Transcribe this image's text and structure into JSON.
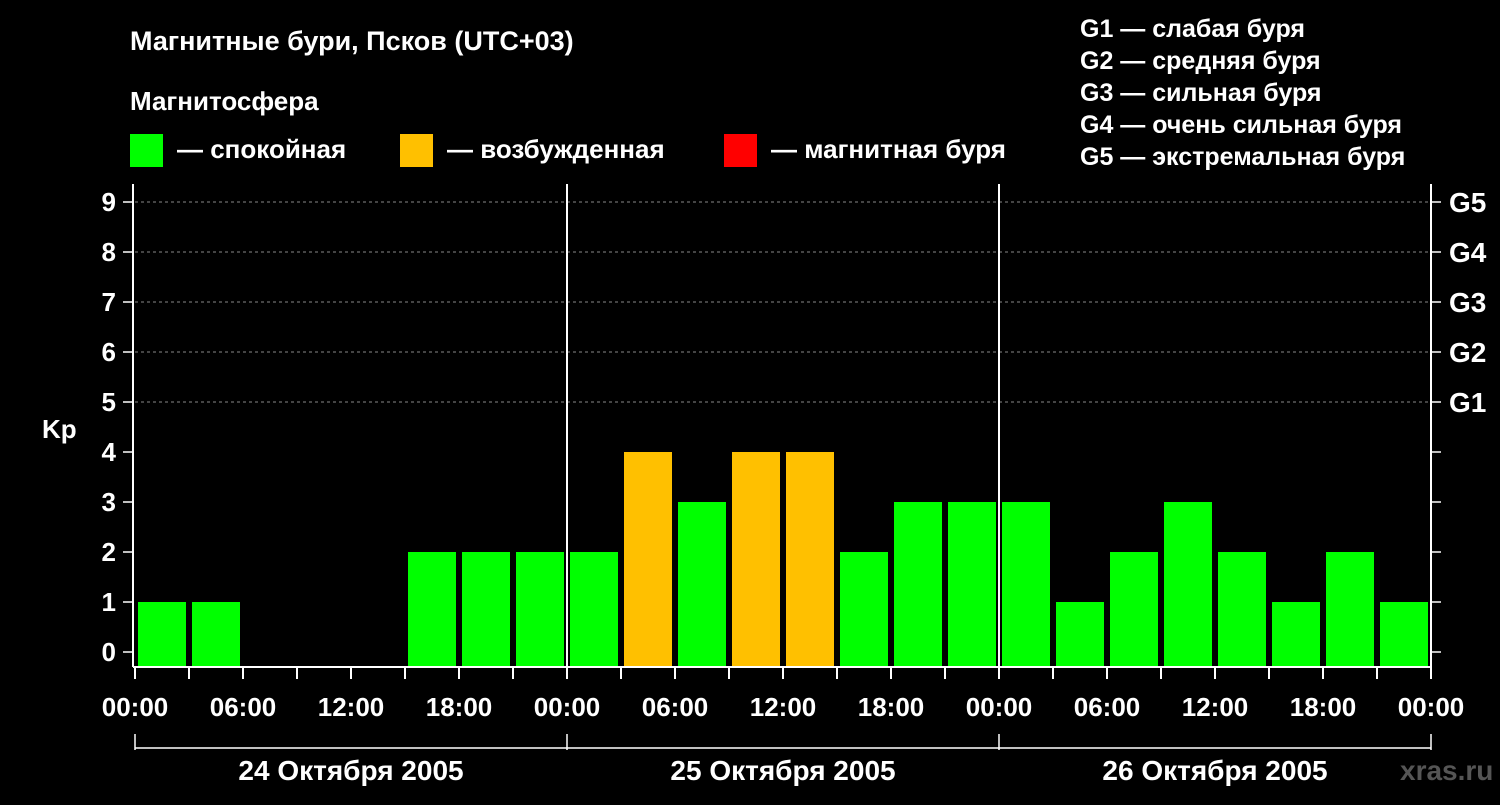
{
  "title": "Магнитные бури, Псков (UTC+03)",
  "subtitle": "Магнитосфера",
  "legend": [
    {
      "label": "— спокойная",
      "color": "#00ff00"
    },
    {
      "label": "— возбужденная",
      "color": "#ffc000"
    },
    {
      "label": "— магнитная буря",
      "color": "#ff0000"
    }
  ],
  "storm_levels": [
    "G1 — слабая буря",
    "G2 — средняя буря",
    "G3 — сильная буря",
    "G4 — очень сильная буря",
    "G5 — экстремальная буря"
  ],
  "watermark": "xras.ru",
  "chart_data": {
    "type": "bar",
    "ylabel": "Kp",
    "ylim": [
      0,
      9
    ],
    "yticks": [
      "0",
      "1",
      "2",
      "3",
      "4",
      "5",
      "6",
      "7",
      "8",
      "9"
    ],
    "right_axis_labels": [
      {
        "kp": 5,
        "label": "G1"
      },
      {
        "kp": 6,
        "label": "G2"
      },
      {
        "kp": 7,
        "label": "G3"
      },
      {
        "kp": 8,
        "label": "G4"
      },
      {
        "kp": 9,
        "label": "G5"
      }
    ],
    "xticks": [
      "00:00",
      "06:00",
      "12:00",
      "18:00",
      "00:00",
      "06:00",
      "12:00",
      "18:00",
      "00:00",
      "06:00",
      "12:00",
      "18:00",
      "00:00"
    ],
    "days": [
      "24 Октября 2005",
      "25 Октября 2005",
      "26 Октября 2005"
    ],
    "interval_hours": 3,
    "values": [
      1,
      1,
      0,
      0,
      0,
      2,
      2,
      2,
      2,
      4,
      3,
      4,
      4,
      2,
      3,
      3,
      3,
      1,
      2,
      3,
      2,
      1,
      2,
      1
    ],
    "colors": {
      "quiet": "#00ff00",
      "active": "#ffc000",
      "storm": "#ff0000"
    },
    "grid": true
  }
}
